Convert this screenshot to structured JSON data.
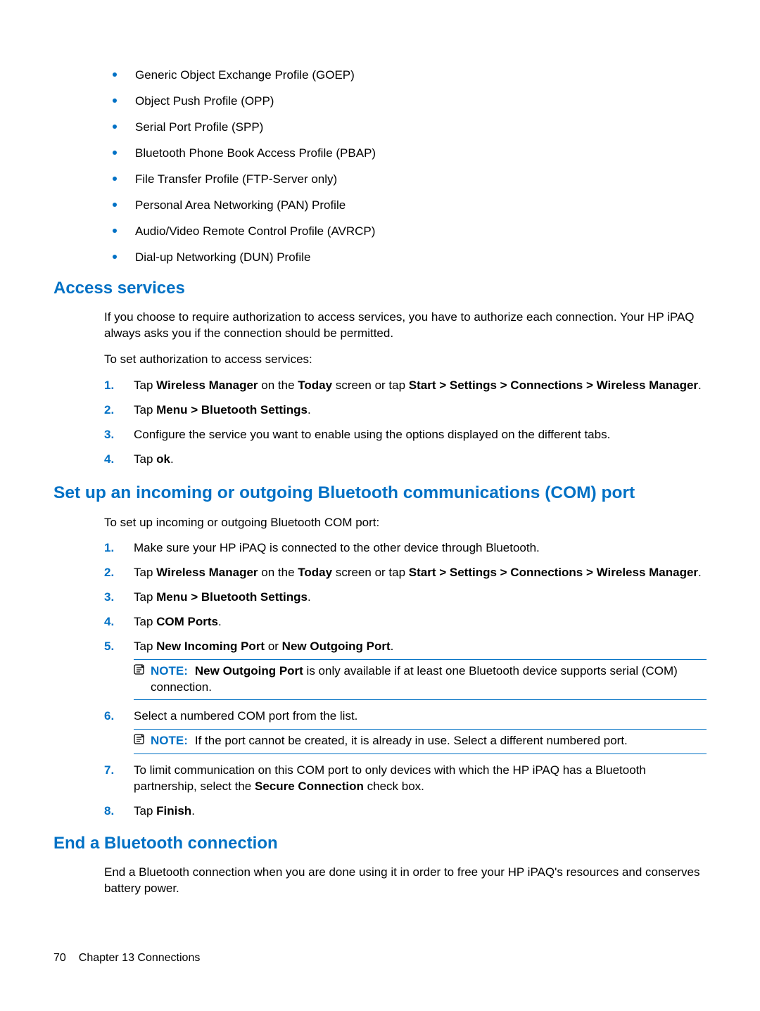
{
  "bullets": [
    "Generic Object Exchange Profile (GOEP)",
    "Object Push Profile (OPP)",
    "Serial Port Profile (SPP)",
    "Bluetooth Phone Book Access Profile (PBAP)",
    "File Transfer Profile (FTP-Server only)",
    "Personal Area Networking (PAN) Profile",
    "Audio/Video Remote Control Profile (AVRCP)",
    "Dial-up Networking (DUN) Profile"
  ],
  "access": {
    "heading": "Access services",
    "intro": "If you choose to require authorization to access services, you have to authorize each connection. Your HP iPAQ always asks you if the connection should be permitted.",
    "lead": "To set authorization to access services:",
    "steps": {
      "n1": "1.",
      "s1a": "Tap ",
      "s1b": "Wireless Manager",
      "s1c": " on the ",
      "s1d": "Today",
      "s1e": " screen or tap ",
      "s1f": "Start > Settings > Connections > Wireless Manager",
      "s1g": ".",
      "n2": "2.",
      "s2a": "Tap ",
      "s2b": "Menu > Bluetooth Settings",
      "s2c": ".",
      "n3": "3.",
      "s3": "Configure the service you want to enable using the options displayed on the different tabs.",
      "n4": "4.",
      "s4a": "Tap ",
      "s4b": "ok",
      "s4c": "."
    }
  },
  "com": {
    "heading": "Set up an incoming or outgoing Bluetooth communications (COM) port",
    "lead": "To set up incoming or outgoing Bluetooth COM port:",
    "steps": {
      "n1": "1.",
      "s1": "Make sure your HP iPAQ is connected to the other device through Bluetooth.",
      "n2": "2.",
      "s2a": "Tap ",
      "s2b": "Wireless Manager",
      "s2c": " on the ",
      "s2d": "Today",
      "s2e": " screen or tap ",
      "s2f": "Start > Settings > Connections > Wireless Manager",
      "s2g": ".",
      "n3": "3.",
      "s3a": "Tap ",
      "s3b": "Menu > Bluetooth Settings",
      "s3c": ".",
      "n4": "4.",
      "s4a": "Tap ",
      "s4b": "COM Ports",
      "s4c": ".",
      "n5": "5.",
      "s5a": "Tap ",
      "s5b": "New Incoming Port",
      "s5c": " or ",
      "s5d": "New Outgoing Port",
      "s5e": ".",
      "note1_label": "NOTE:",
      "note1a": "New Outgoing Port",
      "note1b": " is only available if at least one Bluetooth device supports serial (COM) connection.",
      "n6": "6.",
      "s6": "Select a numbered COM port from the list.",
      "note2_label": "NOTE:",
      "note2": "If the port cannot be created, it is already in use. Select a different numbered port.",
      "n7": "7.",
      "s7a": "To limit communication on this COM port to only devices with which the HP iPAQ has a Bluetooth partnership, select the ",
      "s7b": "Secure Connection",
      "s7c": " check box.",
      "n8": "8.",
      "s8a": "Tap ",
      "s8b": "Finish",
      "s8c": "."
    }
  },
  "end": {
    "heading": "End a Bluetooth connection",
    "para": "End a Bluetooth connection when you are done using it in order to free your HP iPAQ's resources and conserves battery power."
  },
  "footer": {
    "page": "70",
    "chapter": "Chapter 13   Connections"
  }
}
